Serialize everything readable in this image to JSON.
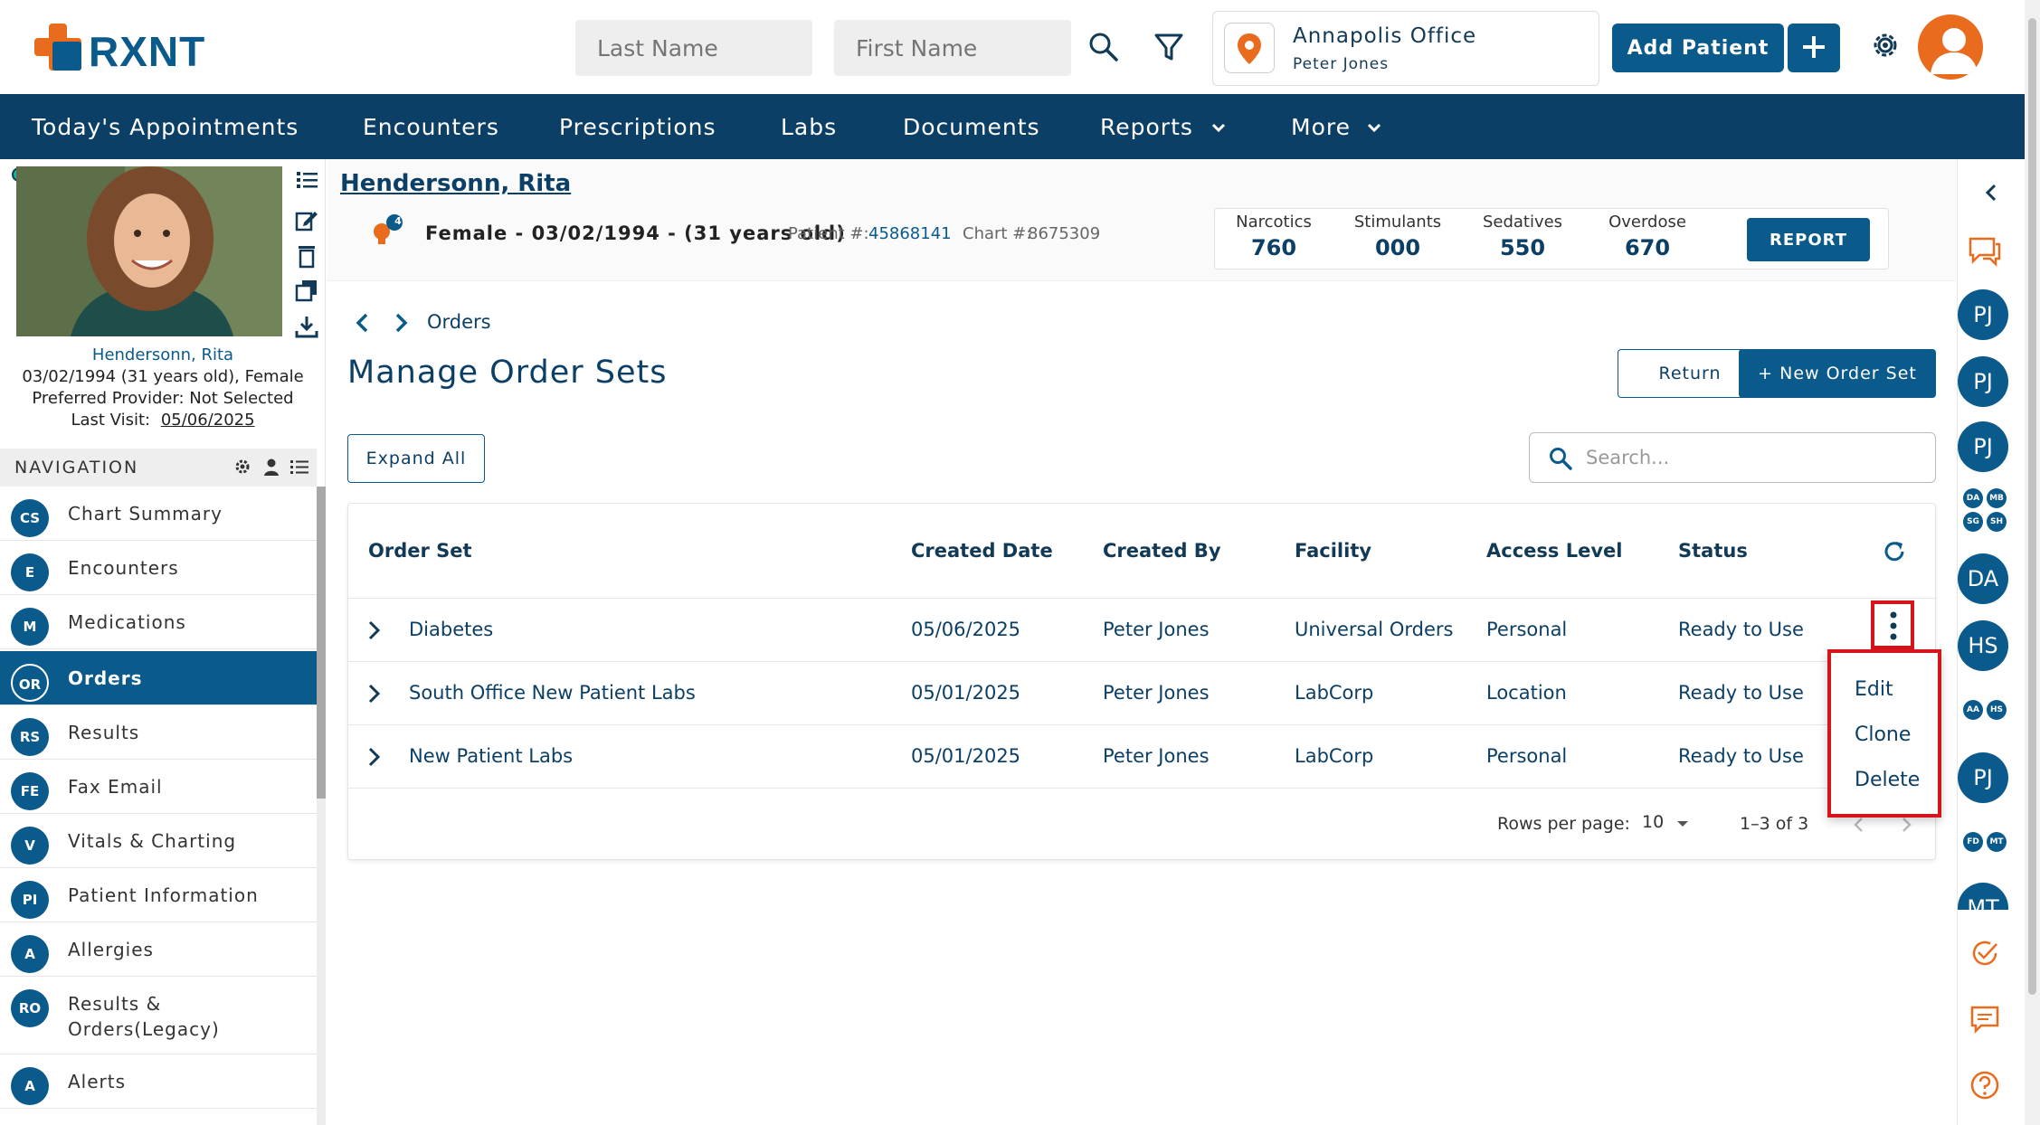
{
  "header": {
    "logo_text": "RXNT",
    "last_name_placeholder": "Last Name",
    "first_name_placeholder": "First Name",
    "location": {
      "office": "Annapolis Office",
      "user": "Peter Jones"
    },
    "add_patient_label": "Add Patient"
  },
  "nav": {
    "items": [
      "Today's Appointments",
      "Encounters",
      "Prescriptions",
      "Labs",
      "Documents",
      "Reports",
      "More"
    ]
  },
  "patient_card": {
    "name": "Hendersonn, Rita",
    "dob_line": "03/02/1994 (31 years old), Female",
    "provider_line": "Preferred Provider: Not Selected",
    "last_visit_label": "Last Visit:",
    "last_visit_date": "05/06/2025"
  },
  "sidenav": {
    "title": "NAVIGATION",
    "items": [
      {
        "abbr": "CS",
        "label": "Chart Summary"
      },
      {
        "abbr": "E",
        "label": "Encounters"
      },
      {
        "abbr": "M",
        "label": "Medications"
      },
      {
        "abbr": "OR",
        "label": "Orders"
      },
      {
        "abbr": "RS",
        "label": "Results"
      },
      {
        "abbr": "FE",
        "label": "Fax Email"
      },
      {
        "abbr": "V",
        "label": "Vitals & Charting"
      },
      {
        "abbr": "PI",
        "label": "Patient Information"
      },
      {
        "abbr": "A",
        "label": "Allergies"
      },
      {
        "abbr": "RO",
        "label": "Results & Orders(Legacy)"
      },
      {
        "abbr": "A",
        "label": "Alerts"
      }
    ],
    "active_index": 3
  },
  "patient_header": {
    "name": "Hendersonn, Rita",
    "alert_count": "4",
    "demographics": "Female - 03/02/1994 - (31 years old)",
    "patient_num_label": "Patient #:",
    "patient_num": "45868141",
    "chart_num_label": "Chart #:",
    "chart_num": "8675309",
    "pdmp": [
      {
        "label": "Narcotics",
        "value": "760"
      },
      {
        "label": "Stimulants",
        "value": "000"
      },
      {
        "label": "Sedatives",
        "value": "550"
      },
      {
        "label": "Overdose",
        "value": "670"
      }
    ],
    "report_label": "REPORT"
  },
  "main": {
    "breadcrumb": "Orders",
    "title": "Manage Order Sets",
    "return_label": "Return",
    "new_order_set_label": "+ New Order Set",
    "expand_all_label": "Expand All",
    "search_placeholder": "Search..."
  },
  "table": {
    "headers": [
      "Order Set",
      "Created Date",
      "Created By",
      "Facility",
      "Access Level",
      "Status"
    ],
    "rows": [
      {
        "order_set": "Diabetes",
        "created_date": "05/06/2025",
        "created_by": "Peter Jones",
        "facility": "Universal Orders",
        "access_level": "Personal",
        "status": "Ready to Use"
      },
      {
        "order_set": "South Office New Patient Labs",
        "created_date": "05/01/2025",
        "created_by": "Peter Jones",
        "facility": "LabCorp",
        "access_level": "Location",
        "status": "Ready to Use"
      },
      {
        "order_set": "New Patient Labs",
        "created_date": "05/01/2025",
        "created_by": "Peter Jones",
        "facility": "LabCorp",
        "access_level": "Personal",
        "status": "Ready to Use"
      }
    ],
    "rows_per_page_label": "Rows per page:",
    "rows_per_page": "10",
    "range": "1–3 of 3"
  },
  "row_menu": {
    "items": [
      "Edit",
      "Clone",
      "Delete"
    ]
  },
  "right_rail": {
    "big_avatars": [
      "PJ",
      "PJ",
      "PJ",
      "DA",
      "HS",
      "PJ",
      "MT"
    ],
    "small_avatars_a": [
      "DA",
      "MB",
      "SG",
      "SH"
    ],
    "small_avatars_b": [
      "AA",
      "HS"
    ],
    "small_avatars_c": [
      "FD",
      "MT"
    ]
  },
  "colors": {
    "primary": "#0a5a8c",
    "navbar": "#0c3f66",
    "accent": "#e96b1e",
    "highlight": "#d6141c"
  }
}
